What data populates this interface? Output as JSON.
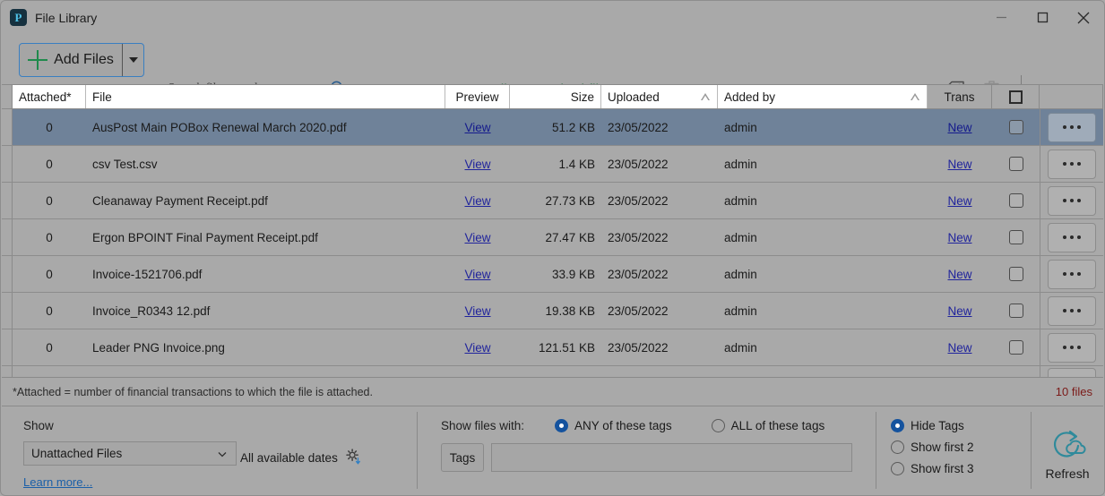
{
  "window": {
    "title": "File Library",
    "app_icon": "app-logo-icon",
    "minimize_label": "Minimize",
    "maximize_label": "Maximize",
    "close_label": "Close"
  },
  "toolbar": {
    "add_files_label": "Add Files",
    "add_files_dropdown": "add-files-dropdown",
    "search_placeholder": "Search file records",
    "search_value": "",
    "center_title": "All Unattached files",
    "center_title_color": "#24703f",
    "tag_edit_icon": "tag-edit-icon",
    "delete_icon": "delete-checked-icon",
    "close_label": "Close"
  },
  "grid": {
    "columns": [
      {
        "key": "attached",
        "label": "Attached*",
        "align": "center"
      },
      {
        "key": "file",
        "label": "File",
        "align": "left"
      },
      {
        "key": "preview",
        "label": "Preview",
        "align": "center"
      },
      {
        "key": "size",
        "label": "Size",
        "align": "right"
      },
      {
        "key": "uploaded",
        "label": "Uploaded",
        "align": "left",
        "sortable": true
      },
      {
        "key": "added_by",
        "label": "Added by",
        "align": "left",
        "sortable": true
      },
      {
        "key": "trans",
        "label": "Trans",
        "align": "center"
      },
      {
        "key": "select",
        "label": "",
        "align": "center"
      },
      {
        "key": "actions",
        "label": "",
        "align": "center"
      }
    ],
    "rows": [
      {
        "attached": "0",
        "file": "AusPost Main POBox Renewal March 2020.pdf",
        "preview": "View",
        "size": "51.2 KB",
        "uploaded": "23/05/2022",
        "added_by": "admin",
        "trans": "New",
        "selected": true,
        "checked": false,
        "actions": "•••"
      },
      {
        "attached": "0",
        "file": "csv Test.csv",
        "preview": "View",
        "size": "1.4 KB",
        "uploaded": "23/05/2022",
        "added_by": "admin",
        "trans": "New",
        "selected": false,
        "checked": false,
        "actions": "•••"
      },
      {
        "attached": "0",
        "file": "Cleanaway Payment Receipt.pdf",
        "preview": "View",
        "size": "27.73 KB",
        "uploaded": "23/05/2022",
        "added_by": "admin",
        "trans": "New",
        "selected": false,
        "checked": false,
        "actions": "•••"
      },
      {
        "attached": "0",
        "file": "Ergon BPOINT Final Payment Receipt.pdf",
        "preview": "View",
        "size": "27.47 KB",
        "uploaded": "23/05/2022",
        "added_by": "admin",
        "trans": "New",
        "selected": false,
        "checked": false,
        "actions": "•••"
      },
      {
        "attached": "0",
        "file": "Invoice-1521706.pdf",
        "preview": "View",
        "size": "33.9 KB",
        "uploaded": "23/05/2022",
        "added_by": "admin",
        "trans": "New",
        "selected": false,
        "checked": false,
        "actions": "•••"
      },
      {
        "attached": "0",
        "file": "Invoice_R0343 12.pdf",
        "preview": "View",
        "size": "19.38 KB",
        "uploaded": "23/05/2022",
        "added_by": "admin",
        "trans": "New",
        "selected": false,
        "checked": false,
        "actions": "•••"
      },
      {
        "attached": "0",
        "file": "Leader PNG Invoice.png",
        "preview": "View",
        "size": "121.51 KB",
        "uploaded": "23/05/2022",
        "added_by": "admin",
        "trans": "New",
        "selected": false,
        "checked": false,
        "actions": "•••"
      }
    ],
    "select_all_checked": false
  },
  "footnote": {
    "text": "*Attached = number of financial transactions to which the file is attached.",
    "file_count": "10 files",
    "file_count_color": "#7b1a18"
  },
  "show_panel": {
    "label": "Show",
    "selected_filter": "Unattached Files",
    "dates_label": "All available dates",
    "dates_icon": "date-settings-icon",
    "learn_more": "Learn more..."
  },
  "tags_panel": {
    "prompt": "Show files with:",
    "any_label": "ANY of these tags",
    "all_label": "ALL of these tags",
    "mode": "any",
    "tags_button": "Tags",
    "tags_value": ""
  },
  "tag_display_panel": {
    "options": [
      {
        "label": "Hide Tags",
        "selected": true
      },
      {
        "label": "Show first 2",
        "selected": false
      },
      {
        "label": "Show first 3",
        "selected": false
      }
    ]
  },
  "refresh_panel": {
    "label": "Refresh",
    "icon": "refresh-cloud-icon",
    "color": "#2f8a9b"
  }
}
